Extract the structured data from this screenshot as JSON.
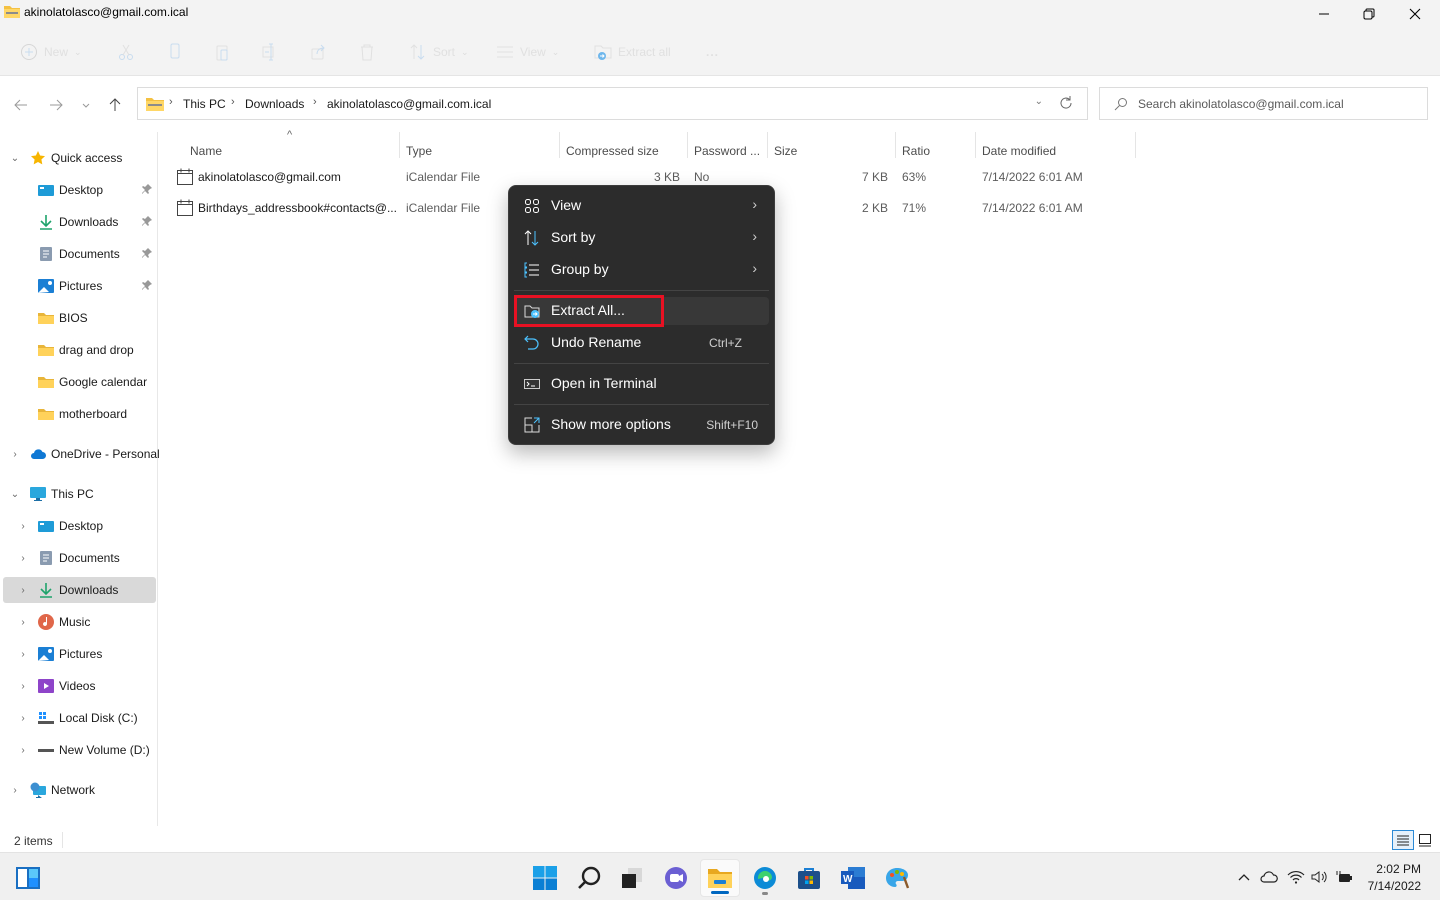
{
  "window": {
    "title": "akinolatolasco@gmail.com.ical",
    "controls": [
      "minimize",
      "restore",
      "close"
    ]
  },
  "commandbar": {
    "new_label": "New",
    "sort_label": "Sort",
    "view_label": "View",
    "extract_all_label": "Extract all",
    "more_label": "..."
  },
  "address": {
    "breadcrumbs": [
      "This PC",
      "Downloads",
      "akinolatolasco@gmail.com.ical"
    ],
    "search_placeholder": "Search akinolatolasco@gmail.com.ical"
  },
  "sidebar": {
    "quick_access": {
      "label": "Quick access",
      "items": [
        {
          "label": "Desktop",
          "icon": "desktop-icon",
          "pinned": true
        },
        {
          "label": "Downloads",
          "icon": "downloads-icon",
          "pinned": true
        },
        {
          "label": "Documents",
          "icon": "documents-icon",
          "pinned": true
        },
        {
          "label": "Pictures",
          "icon": "pictures-icon",
          "pinned": true
        },
        {
          "label": "BIOS",
          "icon": "folder-icon",
          "pinned": false
        },
        {
          "label": "drag and drop",
          "icon": "folder-icon",
          "pinned": false
        },
        {
          "label": "Google calendar",
          "icon": "folder-icon",
          "pinned": false
        },
        {
          "label": "motherboard",
          "icon": "folder-icon",
          "pinned": false
        }
      ]
    },
    "onedrive": {
      "label": "OneDrive - Personal"
    },
    "this_pc": {
      "label": "This PC",
      "items": [
        {
          "label": "Desktop",
          "icon": "desktop-icon"
        },
        {
          "label": "Documents",
          "icon": "documents-icon"
        },
        {
          "label": "Downloads",
          "icon": "downloads-icon",
          "selected": true
        },
        {
          "label": "Music",
          "icon": "music-icon"
        },
        {
          "label": "Pictures",
          "icon": "pictures-icon"
        },
        {
          "label": "Videos",
          "icon": "videos-icon"
        },
        {
          "label": "Local Disk (C:)",
          "icon": "local-disk-icon"
        },
        {
          "label": "New Volume (D:)",
          "icon": "drive-icon"
        }
      ]
    },
    "network": {
      "label": "Network"
    }
  },
  "filelist": {
    "columns": [
      "Name",
      "Type",
      "Compressed size",
      "Password ...",
      "Size",
      "Ratio",
      "Date modified"
    ],
    "sorted_by": "Name",
    "rows": [
      {
        "name": "akinolatolasco@gmail.com",
        "type": "iCalendar File",
        "compressed_size": "3 KB",
        "password": "No",
        "size": "7 KB",
        "ratio": "63%",
        "date_modified": "7/14/2022 6:01 AM"
      },
      {
        "name": "Birthdays_addressbook#contacts@...",
        "type": "iCalendar File",
        "compressed_size": "",
        "password": "",
        "size": "2 KB",
        "ratio": "71%",
        "date_modified": "7/14/2022 6:01 AM"
      }
    ]
  },
  "context_menu": {
    "items": [
      {
        "label": "View",
        "icon": "view-grid-icon",
        "submenu": true
      },
      {
        "label": "Sort by",
        "icon": "sort-icon",
        "submenu": true
      },
      {
        "label": "Group by",
        "icon": "group-icon",
        "submenu": true
      },
      {
        "label": "Extract All...",
        "icon": "extract-icon",
        "highlighted": true
      },
      {
        "label": "Undo Rename",
        "icon": "undo-icon",
        "shortcut": "Ctrl+Z"
      },
      {
        "label": "Open in Terminal",
        "icon": "terminal-icon"
      },
      {
        "label": "Show more options",
        "icon": "more-options-icon",
        "shortcut": "Shift+F10"
      }
    ],
    "highlight_color": "#e81123"
  },
  "statusbar": {
    "item_count": "2 items"
  },
  "taskbar": {
    "apps": [
      "start",
      "search",
      "task-view",
      "teams-chat",
      "file-explorer",
      "edge",
      "store",
      "word",
      "paint"
    ],
    "active_app": "file-explorer",
    "clock_time": "2:02 PM",
    "clock_date": "7/14/2022"
  },
  "colors": {
    "accent": "#0067c0",
    "menu_bg": "#2c2c2c",
    "selection_bg": "#d9d9d9"
  }
}
